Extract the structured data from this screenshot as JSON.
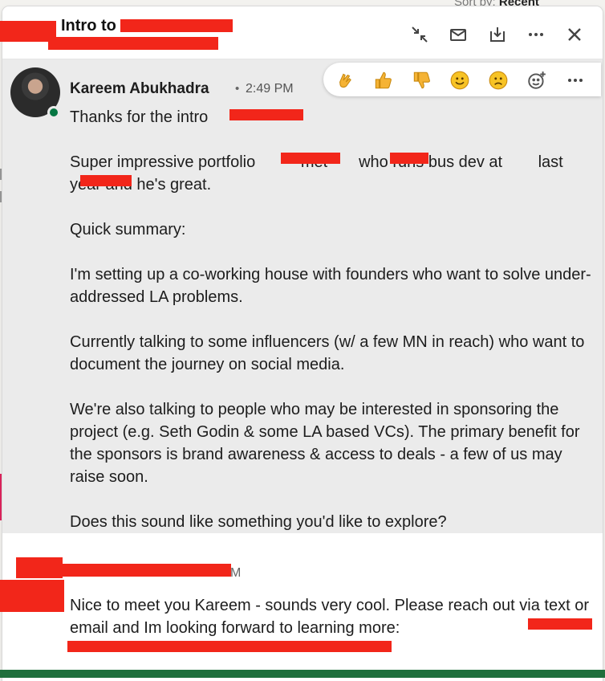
{
  "sort": {
    "label": "Sort by:",
    "value": "Recent"
  },
  "header": {
    "title": "Intro to",
    "buttons": [
      "minimize-icon",
      "mail-icon",
      "archive-icon",
      "more-icon",
      "close-icon"
    ]
  },
  "message1": {
    "sender": "Kareem Abukhadra",
    "separator": "•",
    "time": "2:49 PM",
    "reactions": [
      "clap",
      "thumbs-up",
      "thumbs-down",
      "smile",
      "sad",
      "add-reaction",
      "more"
    ],
    "paragraphs": [
      "Thanks for the intro",
      "Super impressive portfolio        - met       who runs bus dev at        last year and he's great.",
      "Quick summary:",
      "I'm setting up a co-working house with founders who want to solve under-addressed LA problems.",
      "Currently talking to some influencers (w/ a few MN in reach) who want to document the journey on social media.",
      "We're also talking to people who may be interested in sponsoring the project (e.g. Seth Godin & some LA based VCs). The primary benefit for the sponsors is brand awareness & access to deals - a few of us may raise soon.",
      "Does this sound like something you'd like to explore?"
    ]
  },
  "message2": {
    "time_suffix": "M",
    "text": "Nice to meet you Kareem - sounds very cool. Please reach out via text or email and Im looking forward to learning more:"
  },
  "colors": {
    "accent": "#0a66c2",
    "online": "#057642",
    "redaction": "#f2261a"
  }
}
